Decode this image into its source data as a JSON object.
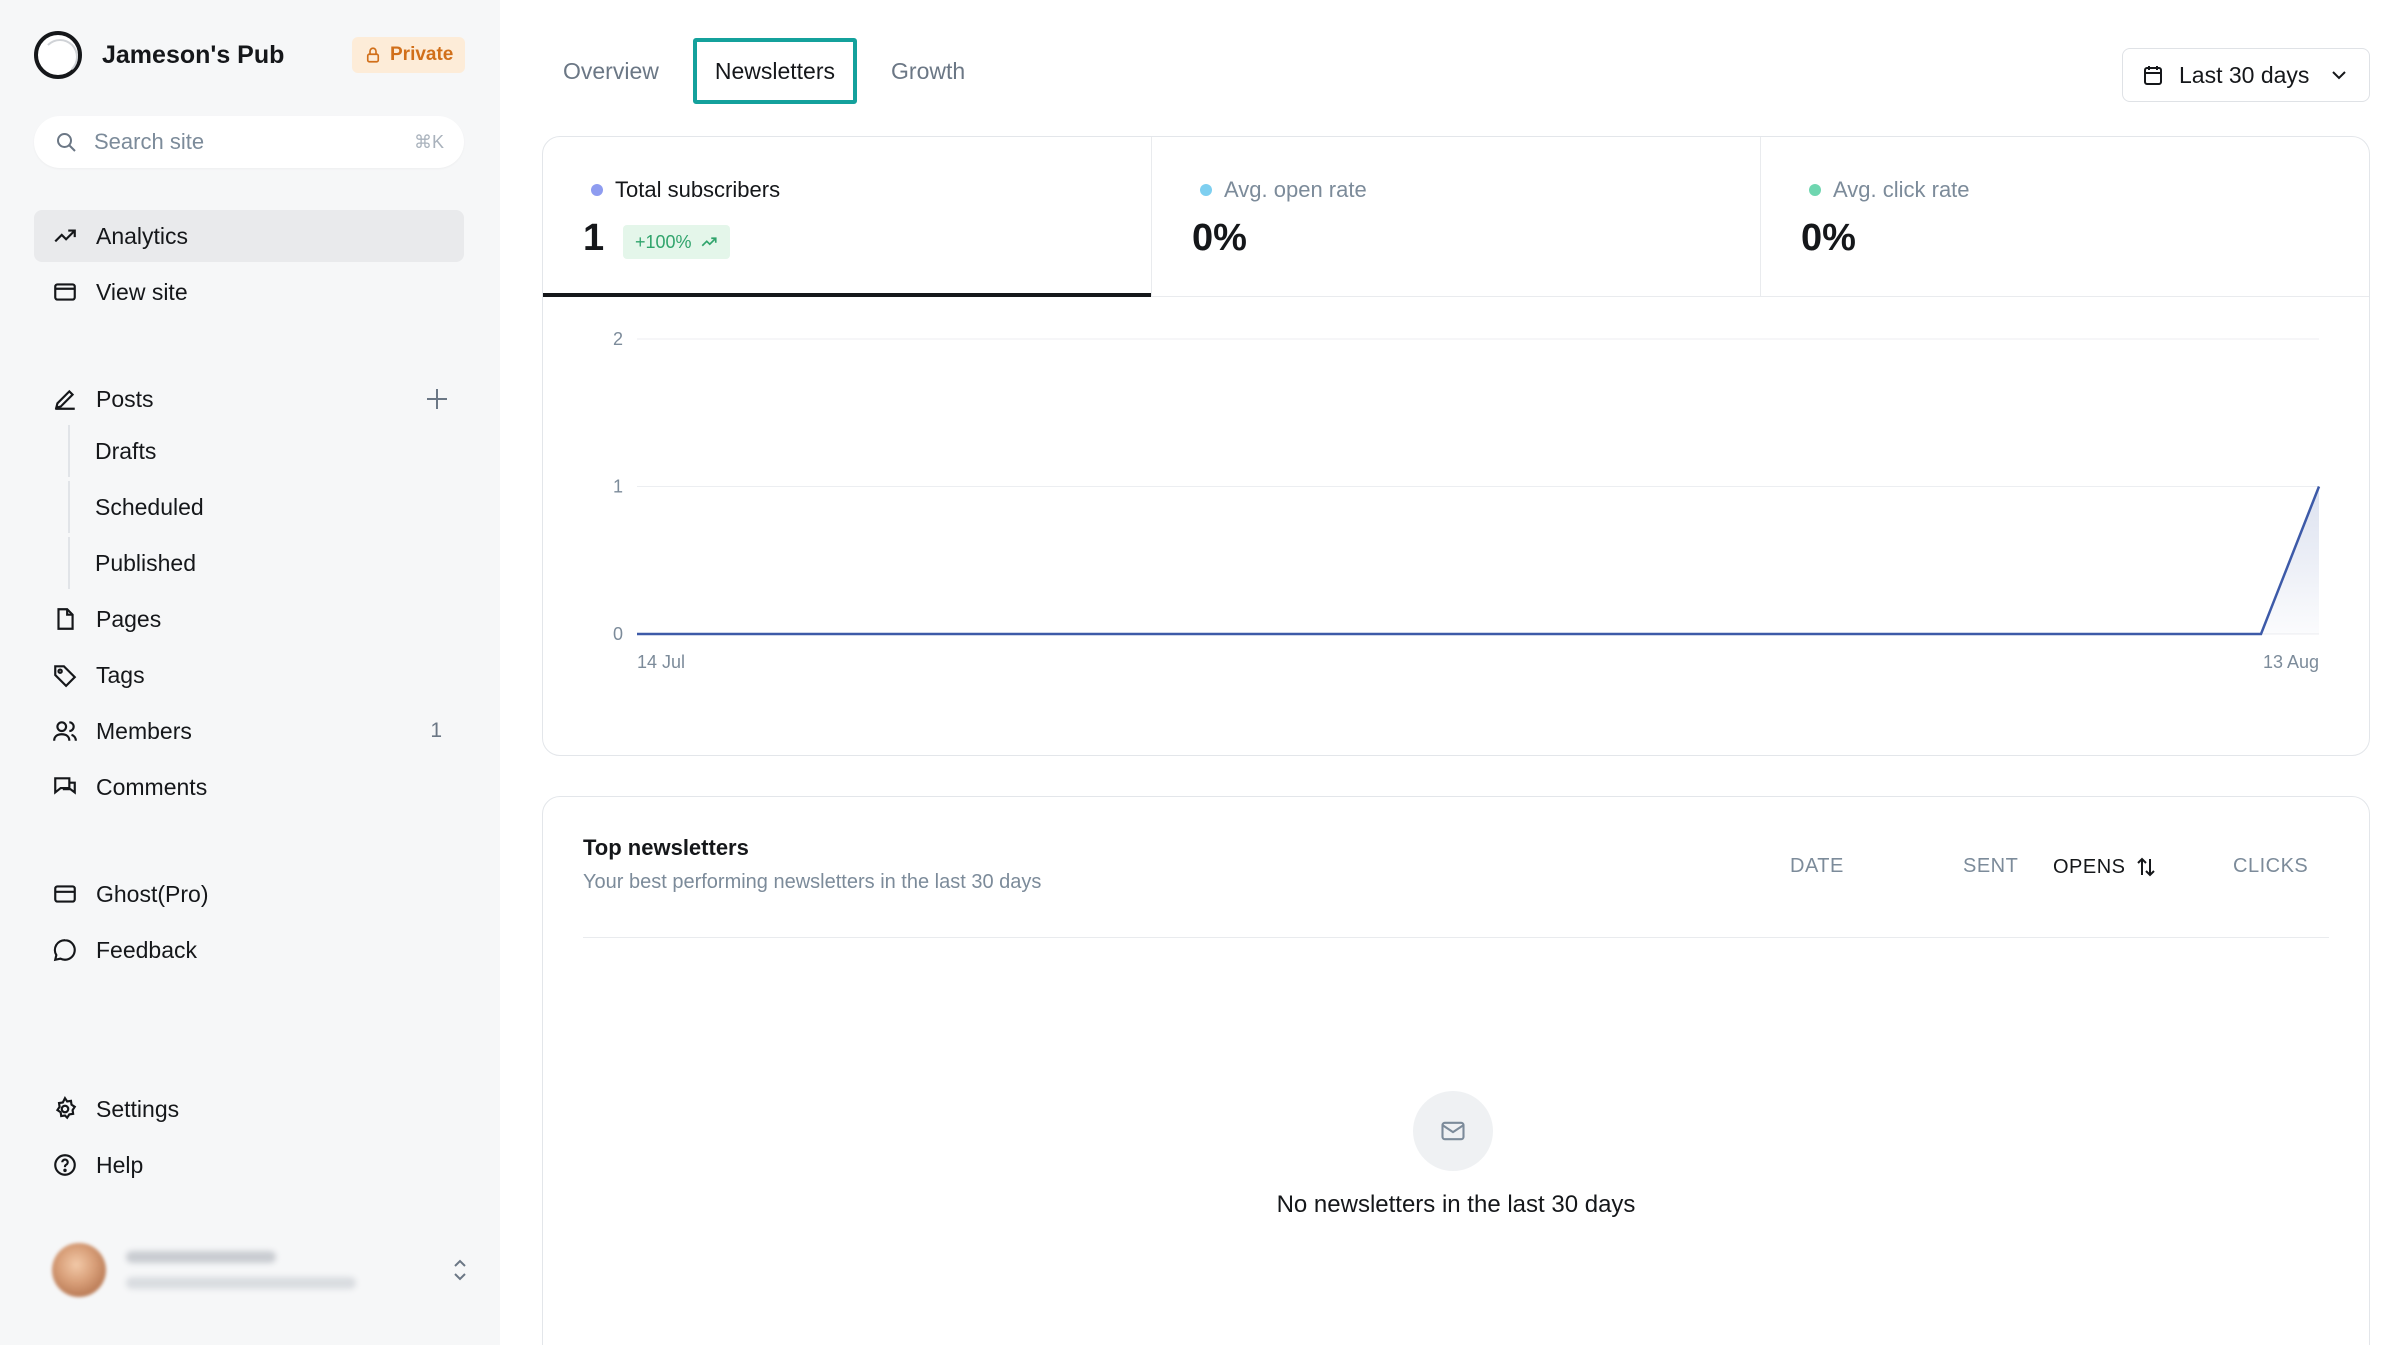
{
  "brand": {
    "name": "Jameson's Pub",
    "badge": "Private"
  },
  "search": {
    "placeholder": "Search site",
    "shortcut": "⌘K"
  },
  "nav": {
    "analytics": "Analytics",
    "view_site": "View site",
    "posts": "Posts",
    "drafts": "Drafts",
    "scheduled": "Scheduled",
    "published": "Published",
    "pages": "Pages",
    "tags": "Tags",
    "members": "Members",
    "members_count": "1",
    "comments": "Comments",
    "ghost_pro": "Ghost(Pro)",
    "feedback": "Feedback",
    "settings": "Settings",
    "help": "Help"
  },
  "tabs": [
    "Overview",
    "Newsletters",
    "Growth"
  ],
  "date_range": "Last 30 days",
  "kpis": [
    {
      "label": "Total subscribers",
      "value": "1",
      "change": "+100%",
      "dot_color": "#8e9cf0"
    },
    {
      "label": "Avg. open rate",
      "value": "0%",
      "dot_color": "#7ecff0"
    },
    {
      "label": "Avg. click rate",
      "value": "0%",
      "dot_color": "#6fd6b0"
    }
  ],
  "chart_data": {
    "type": "area",
    "x_labels": [
      "14 Jul",
      "13 Aug"
    ],
    "y_ticks": [
      0,
      1,
      2
    ],
    "ylim": [
      0,
      2
    ],
    "series": [
      {
        "values": [
          0,
          0,
          0,
          0,
          0,
          0,
          0,
          0,
          0,
          0,
          0,
          0,
          0,
          0,
          0,
          0,
          0,
          0,
          0,
          0,
          0,
          0,
          0,
          0,
          0,
          0,
          0,
          0,
          0,
          1
        ]
      }
    ],
    "color": "#3d5aa8"
  },
  "newsletters": {
    "title": "Top newsletters",
    "subtitle": "Your best performing newsletters in the last 30 days",
    "columns": {
      "date": "DATE",
      "sent": "SENT",
      "opens": "OPENS",
      "clicks": "CLICKS"
    },
    "empty_text": "No newsletters in the last 30 days"
  }
}
